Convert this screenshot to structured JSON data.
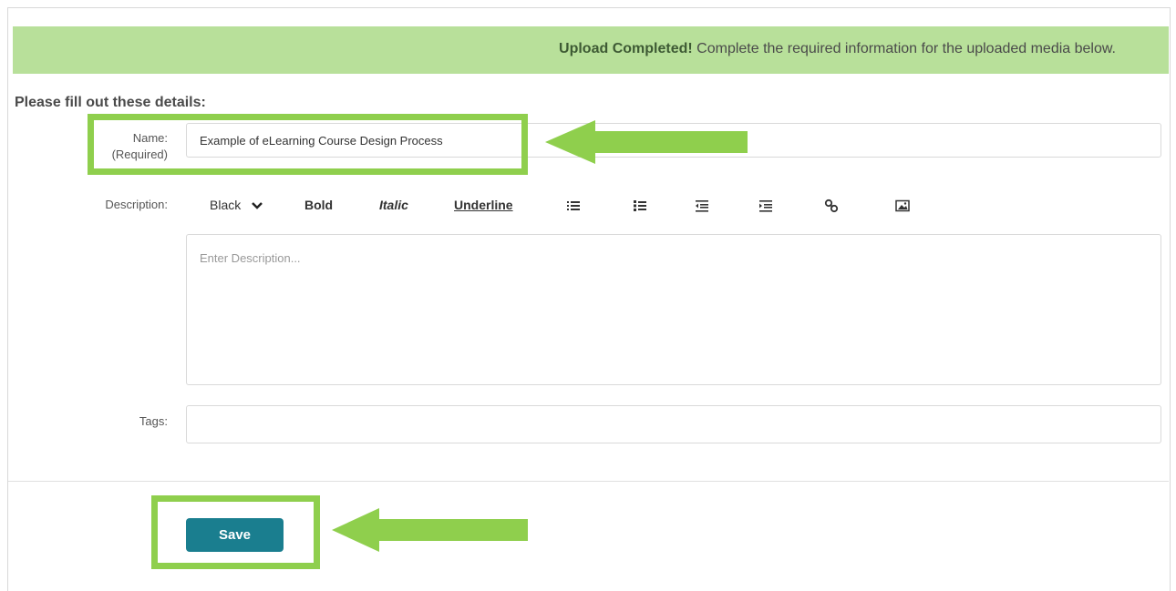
{
  "banner": {
    "strong": "Upload Completed!",
    "message": "Complete the required information for the uploaded media below."
  },
  "form": {
    "title": "Please fill out these details:",
    "name_label": "Name:",
    "name_required": "(Required)",
    "name_value": "Example of eLearning Course Design Process",
    "description_label": "Description:",
    "description_placeholder": "Enter Description...",
    "tags_label": "Tags:",
    "tags_value": ""
  },
  "toolbar": {
    "color": "Black",
    "bold": "Bold",
    "italic": "Italic",
    "underline": "Underline",
    "icons": [
      "unordered-list-icon",
      "ordered-list-icon",
      "outdent-icon",
      "indent-icon",
      "link-icon",
      "image-icon"
    ]
  },
  "actions": {
    "save_label": "Save"
  },
  "colors": {
    "banner_bg": "#b8e09a",
    "annotation_green": "#8fcf4d",
    "save_button": "#1a7e8f"
  }
}
